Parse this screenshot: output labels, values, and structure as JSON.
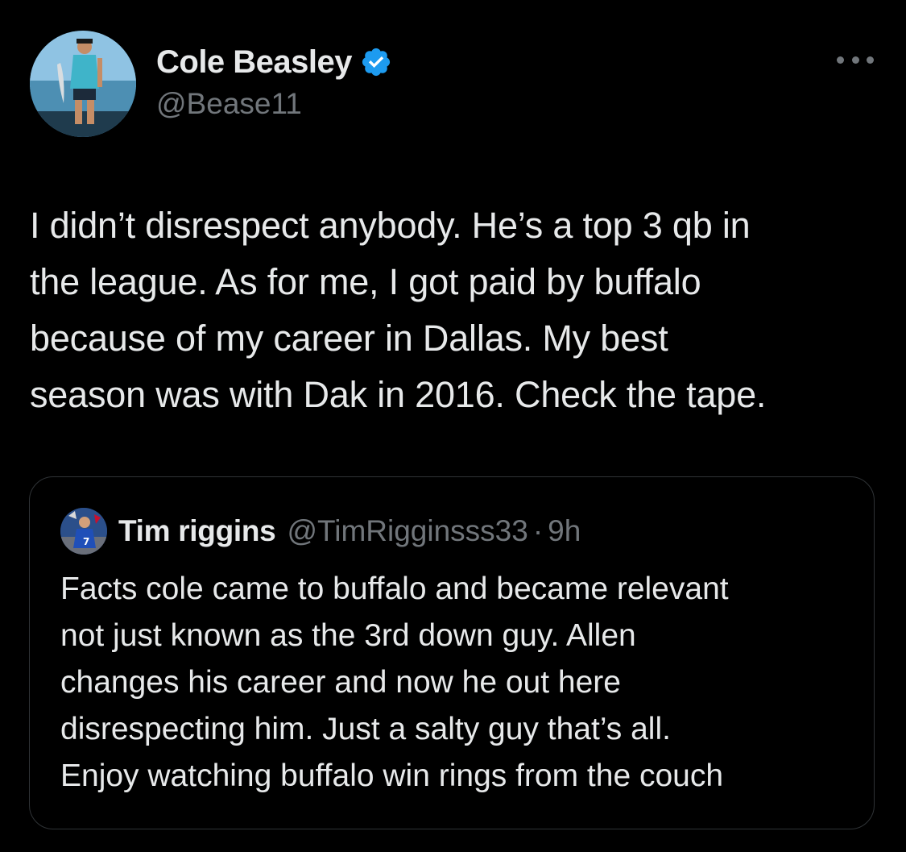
{
  "tweet": {
    "author": {
      "display_name": "Cole Beasley",
      "handle": "@Bease11",
      "verified": true,
      "verified_color": "#1d9bf0"
    },
    "more_icon": "more-horizontal-icon",
    "text_lines": [
      "I didn’t disrespect anybody. He’s a top 3 qb in",
      "the league. As for me, I got paid by buffalo",
      "because of my career in Dallas. My best",
      "season was with Dak in 2016. Check the tape."
    ]
  },
  "quote": {
    "author": {
      "display_name": "Tim riggins",
      "handle": "@TimRigginsss33",
      "separator": "·",
      "time": "9h"
    },
    "text_lines": [
      "Facts cole came to buffalo and became relevant",
      "not just known as the 3rd down guy. Allen",
      "changes his career and now he out here",
      "disrespecting him. Just a salty guy that’s all.",
      "Enjoy watching buffalo win rings from the couch"
    ]
  },
  "colors": {
    "background": "#000000",
    "primary_text": "#e7e9ea",
    "secondary_text": "#71767b",
    "border": "#2f3336",
    "accent": "#1d9bf0"
  }
}
